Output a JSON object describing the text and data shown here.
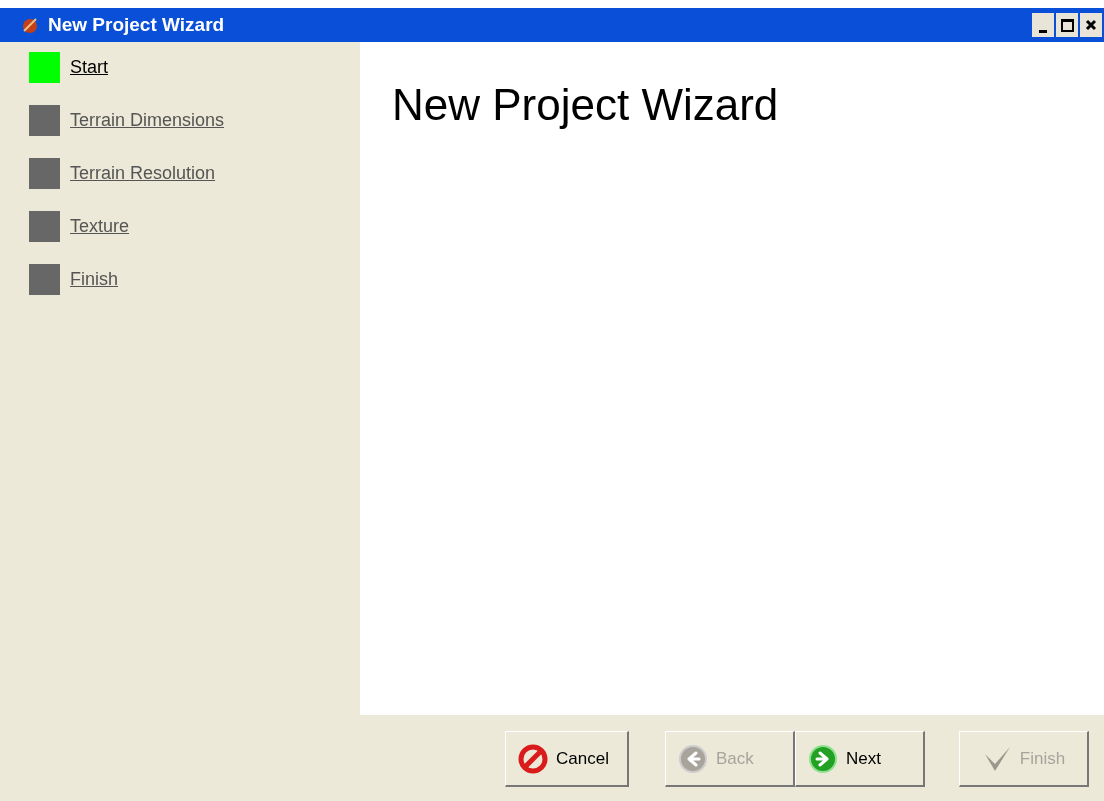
{
  "window": {
    "title": "New Project Wizard"
  },
  "steps": [
    {
      "label": "Start",
      "selected": true
    },
    {
      "label": "Terrain Dimensions",
      "selected": false
    },
    {
      "label": "Terrain Resolution",
      "selected": false
    },
    {
      "label": "Texture",
      "selected": false
    },
    {
      "label": "Finish",
      "selected": false
    }
  ],
  "content": {
    "heading": "New Project Wizard"
  },
  "buttons": [
    {
      "kind": "cancel",
      "label": "Cancel",
      "disabled": false
    },
    {
      "kind": "back",
      "label": "Back",
      "disabled": true
    },
    {
      "kind": "next",
      "label": "Next",
      "disabled": false
    },
    {
      "kind": "finish",
      "label": "Finish",
      "disabled": true
    }
  ]
}
